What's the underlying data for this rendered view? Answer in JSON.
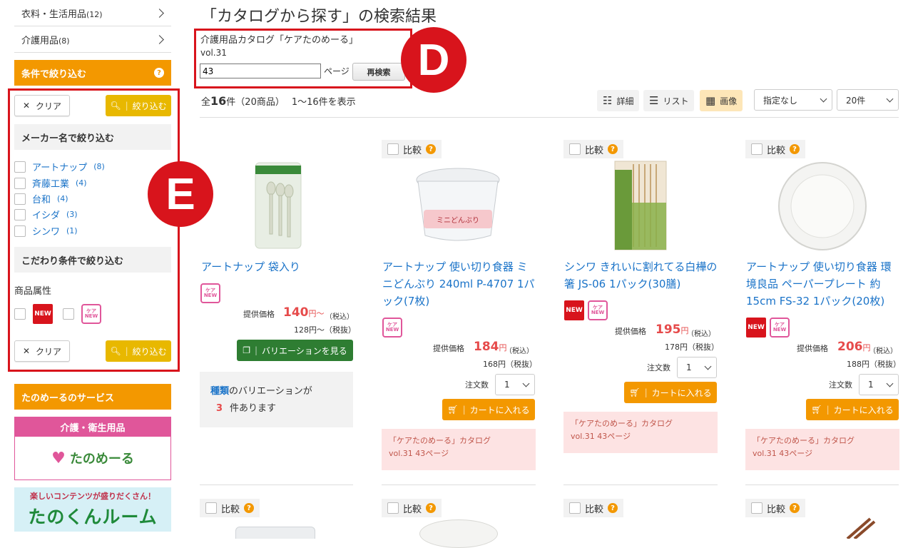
{
  "sidebar": {
    "categories": [
      {
        "label": "衣料・生活用品",
        "count": "(12)"
      },
      {
        "label": "介護用品",
        "count": "(8)"
      }
    ],
    "filter_header": "条件で絞り込む",
    "clear_label": "クリア",
    "narrow_label": "絞り込む",
    "maker_header": "メーカー名で絞り込む",
    "makers": [
      {
        "name": "アートナップ",
        "count": "(8)"
      },
      {
        "name": "斉藤工業",
        "count": "(4)"
      },
      {
        "name": "台和",
        "count": "(4)"
      },
      {
        "name": "イシダ",
        "count": "(3)"
      },
      {
        "name": "シンワ",
        "count": "(1)"
      }
    ],
    "special_header": "こだわり条件で絞り込む",
    "attr_label": "商品属性",
    "service_header": "たのめーるのサービス",
    "banner1_title": "介護・衛生用品",
    "banner1_logo": "たのめーる",
    "banner2_top": "楽しいコンテンツが盛りだくさん！",
    "banner2_main": "たのくんルーム",
    "annotation_e": "E"
  },
  "header": {
    "title": "「カタログから探す」の検索結果",
    "catalog_name": "介護用品カタログ「ケアたのめーる」",
    "catalog_vol": "vol.31",
    "page_value": "43",
    "page_suffix": "ページ",
    "research_label": "再検索",
    "annotation_d": "D"
  },
  "results": {
    "prefix": "全",
    "total": "16",
    "total_unit": "件",
    "products_count": "（20商品）",
    "range": "1〜16件を表示",
    "views": [
      {
        "label": "詳細"
      },
      {
        "label": "リスト"
      },
      {
        "label": "画像"
      }
    ],
    "sort_value": "指定なし",
    "perpage_value": "20件"
  },
  "badges": {
    "new": "NEW",
    "care_top": "ケア",
    "care_bottom": "NEW"
  },
  "compare_label": "比較",
  "products": [
    {
      "name": "アートナップ 袋入り",
      "price_label": "提供価格",
      "price": "140",
      "price_unit": "円〜",
      "tax_in": "（税込）",
      "sub_price": "128円〜（税抜）",
      "variation_label": "バリエーションを見る",
      "variation_note_a": "種類",
      "variation_note_b": "のバリエーションが",
      "variation_count": "3",
      "variation_note_c": "件あります"
    },
    {
      "name": "アートナップ 使い切り食器 ミニどんぶり 240ml P-4707 1パック(7枚)",
      "price_label": "提供価格",
      "price": "184",
      "price_unit": "円",
      "tax_in": "（税込）",
      "sub_price": "168円（税抜）",
      "qty_label": "注文数",
      "qty": "1",
      "cart_label": "カートに入れる",
      "catalog_line1": "「ケアたのめーる」カタログ",
      "catalog_line2": "vol.31 43ページ"
    },
    {
      "name": "シンワ きれいに割れてる白樺の箸 JS-06 1パック(30膳)",
      "price_label": "提供価格",
      "price": "195",
      "price_unit": "円",
      "tax_in": "（税込）",
      "sub_price": "178円（税抜）",
      "qty_label": "注文数",
      "qty": "1",
      "cart_label": "カートに入れる",
      "catalog_line1": "「ケアたのめーる」カタログ",
      "catalog_line2": "vol.31 43ページ"
    },
    {
      "name": "アートナップ 使い切り食器 環境良品 ペーパープレート 約15cm FS-32 1パック(20枚)",
      "price_label": "提供価格",
      "price": "206",
      "price_unit": "円",
      "tax_in": "（税込）",
      "sub_price": "188円（税抜）",
      "qty_label": "注文数",
      "qty": "1",
      "cart_label": "カートに入れる",
      "catalog_line1": "「ケアたのめーる」カタログ",
      "catalog_line2": "vol.31 43ページ"
    }
  ],
  "colors": {
    "accent": "#f39800",
    "link": "#1a73c8",
    "price": "#e64b4b",
    "alert": "#d8141c",
    "green": "#2e7d32"
  }
}
